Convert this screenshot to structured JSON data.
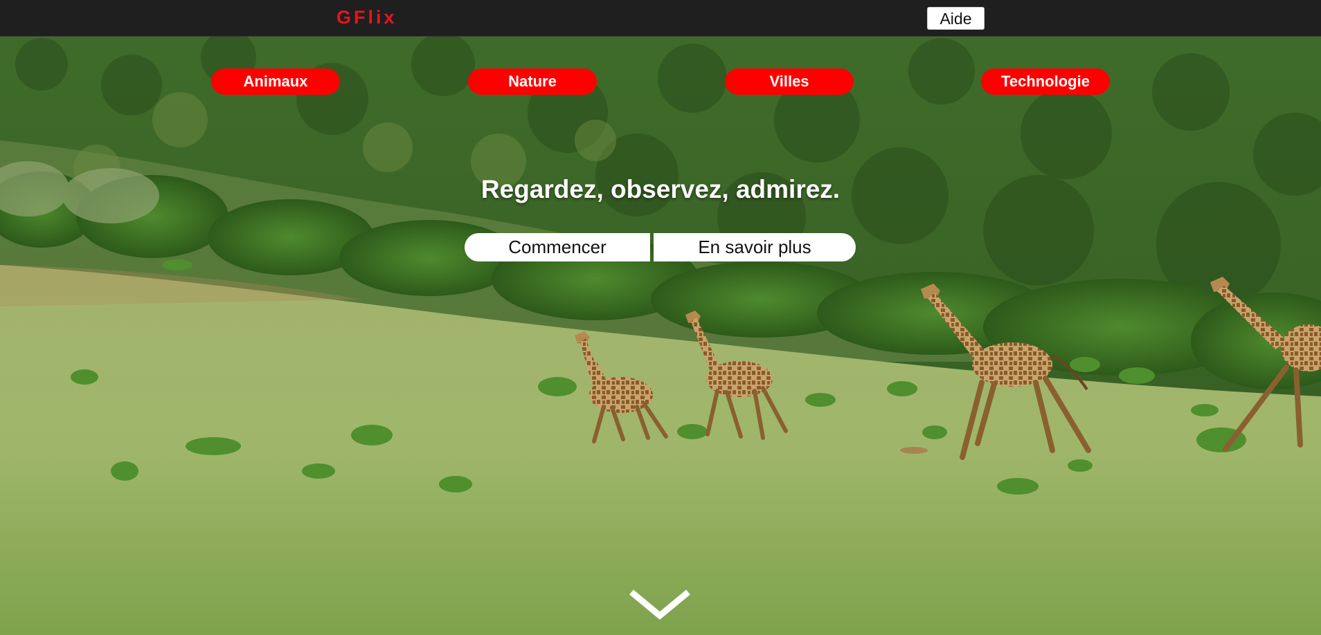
{
  "header": {
    "logo": "GFlix",
    "help_label": "Aide"
  },
  "categories": [
    {
      "label": "Animaux"
    },
    {
      "label": "Nature"
    },
    {
      "label": "Villes"
    },
    {
      "label": "Technologie"
    }
  ],
  "hero": {
    "tagline": "Regardez, observez, admirez.",
    "start_label": "Commencer",
    "more_label": "En savoir plus",
    "scroll_icon": "chevron-down-icon",
    "background_image": "giraffes-running-savanna"
  },
  "colors": {
    "brand_red": "#e8141c",
    "category_red": "#ff0000",
    "topbar": "#1f1f1f"
  }
}
